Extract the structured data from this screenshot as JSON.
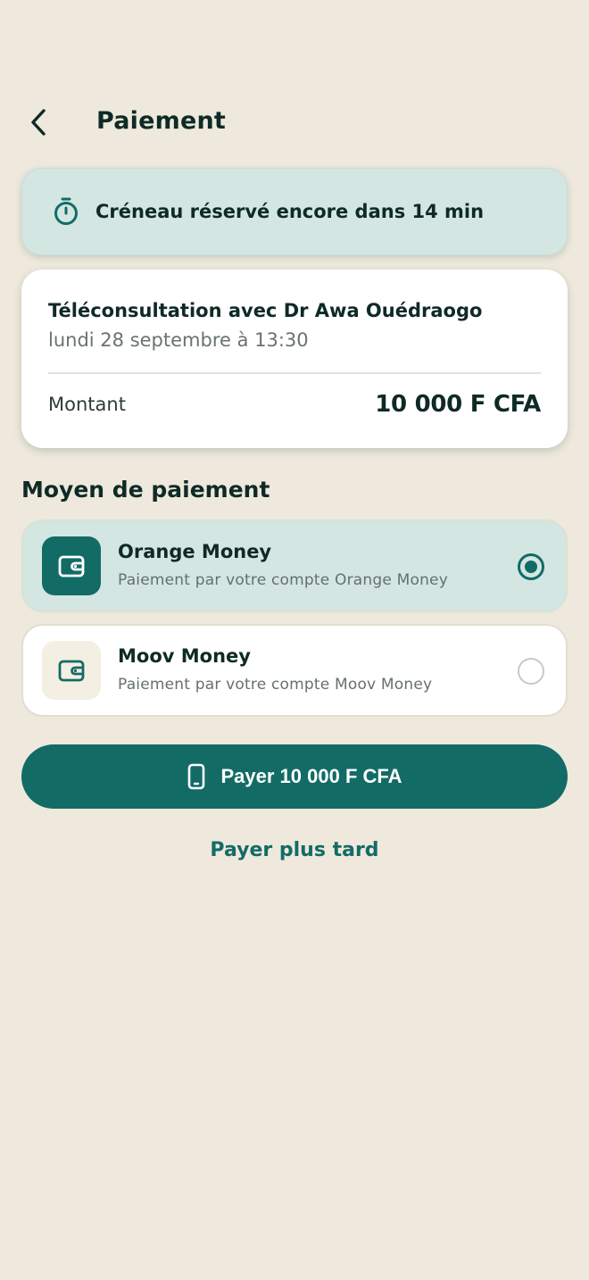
{
  "header": {
    "title": "Paiement",
    "back_icon": "chevron-left-icon"
  },
  "timer": {
    "icon": "stopwatch-icon",
    "text": "Créneau réservé encore dans 14 min"
  },
  "appointment": {
    "title": "Téléconsultation avec Dr Awa Ouédraogo",
    "datetime": "lundi 28 septembre à 13:30",
    "amount_label": "Montant",
    "amount_value": "10 000 F CFA"
  },
  "payment_methods": {
    "heading": "Moyen de paiement",
    "options": [
      {
        "name": "Orange Money",
        "description": "Paiement par votre compte Orange Money",
        "icon": "wallet-icon",
        "selected": true
      },
      {
        "name": "Moov Money",
        "description": "Paiement par votre compte Moov Money",
        "icon": "wallet-icon",
        "selected": false
      }
    ]
  },
  "actions": {
    "pay_label": "Payer 10 000 F CFA",
    "pay_icon": "smartphone-icon",
    "later_label": "Payer plus tard"
  },
  "colors": {
    "background": "#EEE9DC",
    "primary": "#136B66",
    "highlight": "#D3E6E2",
    "text": "#0F2A26"
  }
}
